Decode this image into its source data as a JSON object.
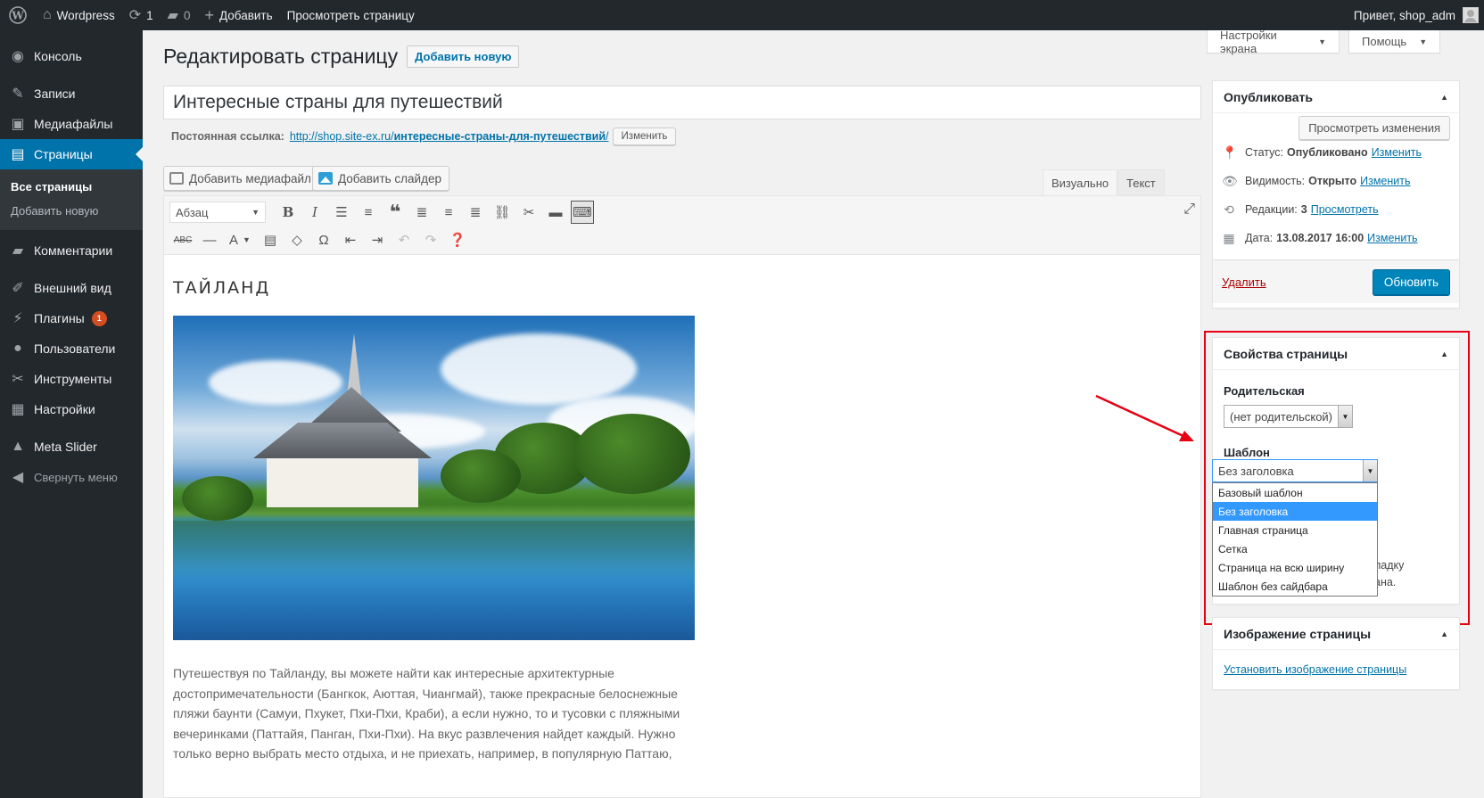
{
  "adminbar": {
    "site_name": "Wordpress",
    "updates_count": "1",
    "comments_count": "0",
    "add_new": "Добавить",
    "view_page": "Просмотреть страницу",
    "greeting": "Привет, shop_adm"
  },
  "sidebar": {
    "items": [
      {
        "label": "Консоль",
        "icon": "dashboard-icon"
      },
      {
        "label": "Записи",
        "icon": "pin-icon"
      },
      {
        "label": "Медиафайлы",
        "icon": "media-icon"
      },
      {
        "label": "Страницы",
        "icon": "pages-icon"
      },
      {
        "label": "Комментарии",
        "icon": "comment-icon"
      },
      {
        "label": "Внешний вид",
        "icon": "brush-icon"
      },
      {
        "label": "Плагины",
        "icon": "plugin-icon",
        "badge": "1"
      },
      {
        "label": "Пользователи",
        "icon": "user-icon"
      },
      {
        "label": "Инструменты",
        "icon": "wrench-icon"
      },
      {
        "label": "Настройки",
        "icon": "settings-icon"
      },
      {
        "label": "Meta Slider",
        "icon": "mountain-icon"
      },
      {
        "label": "Свернуть меню",
        "icon": "collapse-icon"
      }
    ],
    "submenu": [
      "Все страницы",
      "Добавить новую"
    ]
  },
  "screen_options": "Настройки экрана",
  "help": "Помощь",
  "page": {
    "heading": "Редактировать страницу",
    "add_new": "Добавить новую",
    "title": "Интересные страны для путешествий",
    "permalink_label": "Постоянная ссылка:",
    "permalink_base": "http://shop.site-ex.ru/",
    "permalink_slug": "интересные-страны-для-путешествий",
    "permalink_tail": "/",
    "permalink_edit": "Изменить"
  },
  "editor": {
    "add_media": "Добавить медиафайл",
    "add_slider": "Добавить слайдер",
    "tab_visual": "Визуально",
    "tab_text": "Текст",
    "format_value": "Абзац",
    "content_heading": "ТАЙЛАНД",
    "content_paragraph": "Путешествуя по Тайланду, вы можете найти как интересные архитектурные достопримечательности (Бангкок, Аюттая, Чиангмай), также прекрасные белоснежные пляжи баунти (Самуи, Пхукет, Пхи-Пхи, Краби), а если нужно, то и тусовки с пляжными вечеринками (Паттайя, Панган, Пхи-Пхи). На вкус развлечения найдет каждый. Нужно только верно выбрать место отдыха, и не приехать, например, в популярную Паттаю,"
  },
  "publish": {
    "title": "Опубликовать",
    "preview_changes": "Просмотреть изменения",
    "status_label": "Статус:",
    "status_value": "Опубликовано",
    "status_edit": "Изменить",
    "visibility_label": "Видимость:",
    "visibility_value": "Открыто",
    "visibility_edit": "Изменить",
    "revisions_label": "Редакции:",
    "revisions_value": "3",
    "revisions_view": "Просмотреть",
    "date_label": "Дата:",
    "date_value": "13.08.2017 16:00",
    "date_edit": "Изменить",
    "delete": "Удалить",
    "update": "Обновить"
  },
  "page_attributes": {
    "title": "Свойства страницы",
    "parent_label": "Родительская",
    "parent_value": "(нет родительской)",
    "template_label": "Шаблон",
    "template_value": "Без заголовка",
    "template_options": [
      "Базовый шаблон",
      "Без заголовка",
      "Главная страница",
      "Сетка",
      "Страница на всю ширину",
      "Шаблон без сайдбара"
    ],
    "template_selected_index": 1,
    "hidden_text_1": "ладку",
    "hidden_text_2": "ана."
  },
  "featured_image": {
    "title": "Изображение страницы",
    "set_link": "Установить изображение страницы"
  },
  "colors": {
    "admin_dark": "#23282d",
    "accent": "#0073aa",
    "primary_button": "#0085ba",
    "highlight": "#e60012",
    "badge": "#d54e21"
  }
}
